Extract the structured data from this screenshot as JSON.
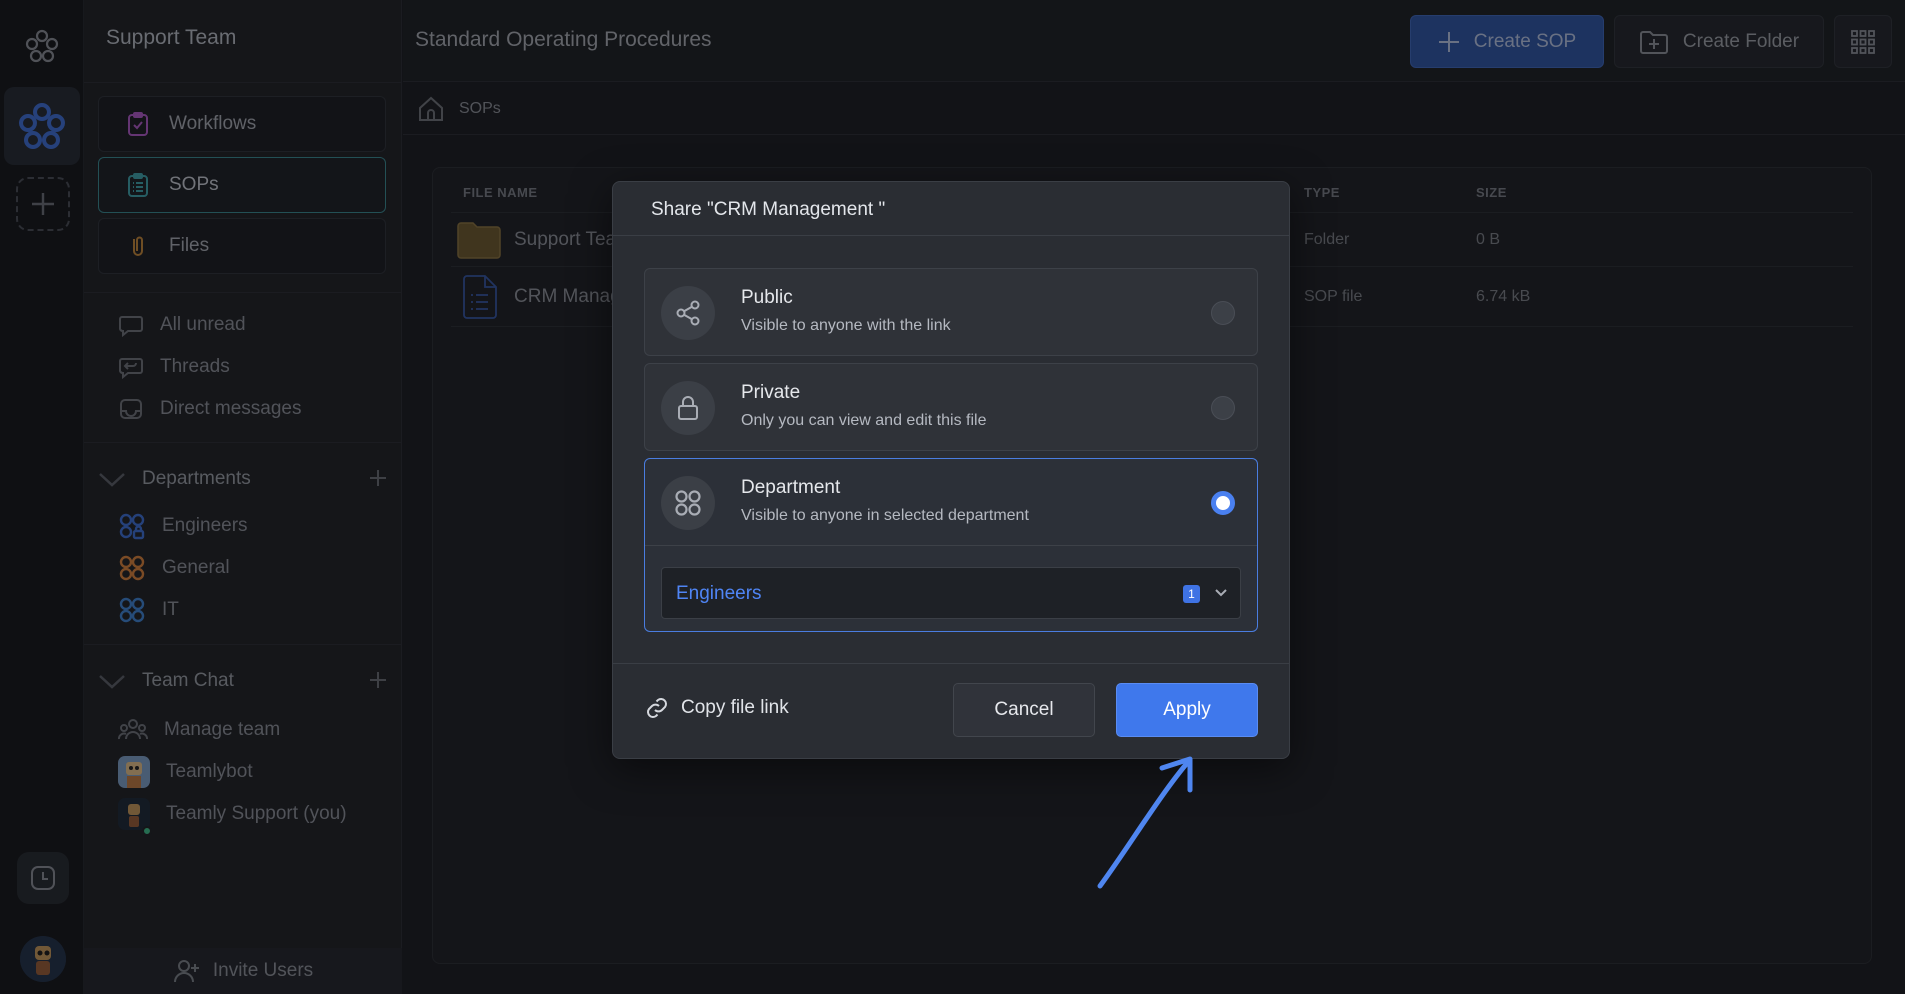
{
  "sidebar": {
    "team_name": "Support Team",
    "nav": [
      {
        "label": "Workflows",
        "icon": "clipboard-check-icon"
      },
      {
        "label": "SOPs",
        "icon": "list-document-icon"
      },
      {
        "label": "Files",
        "icon": "paperclip-icon"
      }
    ],
    "inbox": [
      {
        "label": "All unread",
        "icon": "chat-bubble-icon"
      },
      {
        "label": "Threads",
        "icon": "thread-icon"
      },
      {
        "label": "Direct messages",
        "icon": "inbox-icon"
      }
    ],
    "departments": {
      "heading": "Departments",
      "items": [
        {
          "label": "Engineers",
          "color": "#3d6fd6"
        },
        {
          "label": "General",
          "color": "#d9823b"
        },
        {
          "label": "IT",
          "color": "#3f84d4"
        }
      ]
    },
    "team_chat": {
      "heading": "Team Chat",
      "items": [
        {
          "label": "Manage team"
        },
        {
          "label": "Teamlybot"
        },
        {
          "label": "Teamly Support (you)"
        }
      ]
    },
    "invite_label": "Invite Users"
  },
  "header": {
    "title": "Standard Operating Procedures",
    "create_sop": "Create SOP",
    "create_folder": "Create Folder"
  },
  "breadcrumb": {
    "current": "SOPs"
  },
  "table": {
    "columns": {
      "name": "FILE NAME",
      "type": "TYPE",
      "size": "SIZE"
    },
    "rows": [
      {
        "name": "Support Tea",
        "type": "Folder",
        "size": "0 B"
      },
      {
        "name": "CRM Manag",
        "type": "SOP file",
        "size": "6.74 kB"
      }
    ]
  },
  "dialog": {
    "title": "Share \"CRM Management \"",
    "options": [
      {
        "title": "Public",
        "desc": "Visible to anyone with the link",
        "icon": "share-icon",
        "selected": false
      },
      {
        "title": "Private",
        "desc": "Only you can view and edit this file",
        "icon": "lock-icon",
        "selected": false
      },
      {
        "title": "Department",
        "desc": "Visible to anyone in selected department",
        "icon": "departments-icon",
        "selected": true
      }
    ],
    "department_select": {
      "value": "Engineers",
      "count": "1"
    },
    "copy_link": "Copy file link",
    "cancel": "Cancel",
    "apply": "Apply"
  },
  "colors": {
    "accent": "#3f78ec",
    "selected_border": "#4a7de0",
    "annotation_arrow": "#4f86f0"
  }
}
